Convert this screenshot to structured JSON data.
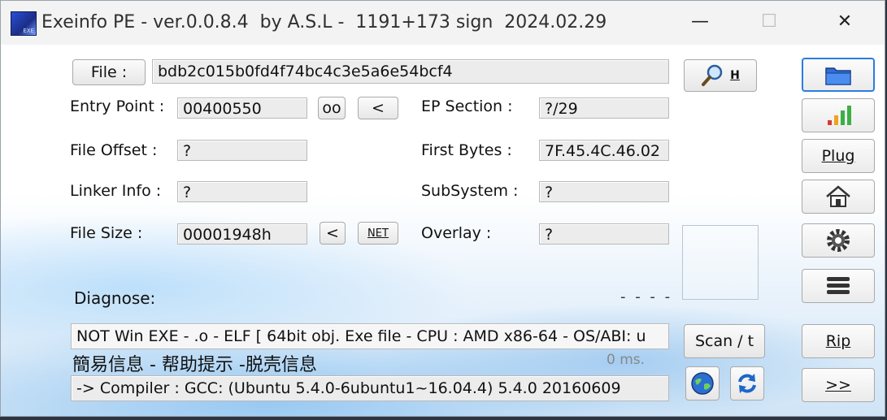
{
  "window": {
    "title": "Exeinfo PE - ver.0.0.8.4  by A.S.L -  1191+173 sign  2024.02.29",
    "app_icon_text": "EXE",
    "minimize": "—",
    "maximize": "☐",
    "close": "✕"
  },
  "file": {
    "button_label": "File :",
    "value": "bdb2c015b0fd4f74bc4c3e5a6e54bcf4",
    "search_button_hotkey": "H"
  },
  "fields": {
    "entry_point": {
      "label": "Entry Point :",
      "value": "00400550"
    },
    "ep_section": {
      "label": "EP Section :",
      "value": "?/29"
    },
    "file_offset": {
      "label": "File Offset :",
      "value": "?"
    },
    "first_bytes": {
      "label": "First Bytes :",
      "value": "7F.45.4C.46.02"
    },
    "linker_info": {
      "label": "Linker Info :",
      "value": "?"
    },
    "subsystem": {
      "label": "SubSystem :",
      "value": "?"
    },
    "file_size": {
      "label": "File Size :",
      "value": "00001948h"
    },
    "overlay": {
      "label": "Overlay :",
      "value": "?"
    }
  },
  "buttons": {
    "oo": "oo",
    "entry_prev": "<",
    "size_prev": "<",
    "net": "NET",
    "scan": "Scan / t",
    "plug": "Plug",
    "rip": "Rip",
    "next": ">>"
  },
  "diagnose": {
    "label": "Diagnose:",
    "dashes": "- - - -",
    "result": "NOT Win EXE - .o - ELF  [ 64bit obj. Exe file - CPU : AMD x86-64 - OS/ABI: u",
    "help_text": "簡易信息 - 帮助提示 -脱壳信息",
    "time": "0 ms.",
    "compiler": " -> Compiler : GCC: (Ubuntu 5.4.0-6ubuntu1~16.04.4) 5.4.0 20160609"
  },
  "icons": {
    "open_folder": "folder-icon",
    "stats": "bar-chart-icon",
    "home": "home-icon",
    "settings": "gear-icon",
    "menu": "menu-icon",
    "web": "globe-icon",
    "refresh": "refresh-icon",
    "search": "magnifier-icon"
  }
}
